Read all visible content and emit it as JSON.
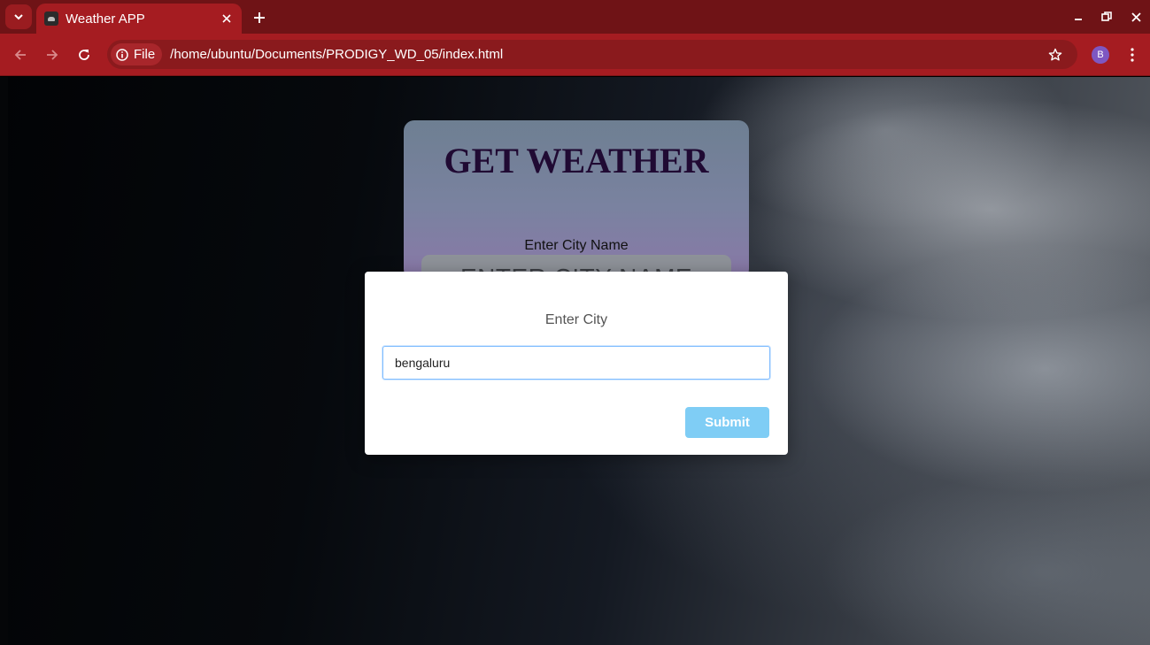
{
  "browser": {
    "tab_title": "Weather APP",
    "site_chip_label": "File",
    "url": "/home/ubuntu/Documents/PRODIGY_WD_05/index.html",
    "profile_initial": "B",
    "theme_color": "#a51c21"
  },
  "page": {
    "card": {
      "title": "GET WEATHER",
      "label": "Enter City Name",
      "input_placeholder": "ENTER CITY NAME"
    },
    "modal": {
      "title": "Enter City",
      "input_value": "bengaluru",
      "submit_label": "Submit",
      "submit_color": "#7fcdf5"
    }
  }
}
